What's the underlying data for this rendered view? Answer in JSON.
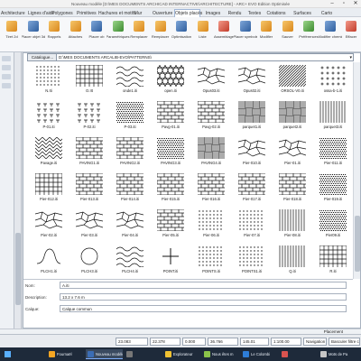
{
  "window": {
    "title": "Nouveau modèle [D:\\MES DOCUMENTS ARCHICAD INTERNACTIVE\\ARCHITECTURE] - ARC+ EVO Edition Optimisée"
  },
  "tabs": [
    "Architecture",
    "Lignes d'aide",
    "Polygones",
    "Primitives",
    "Hachures et motifs",
    "Mur",
    "Ouverture",
    "Objets placés",
    "Images",
    "Rendu",
    "Textes",
    "Cotations",
    "Surfaces",
    "Carto"
  ],
  "active_tab": 7,
  "ribbon": [
    "Tiret 2d",
    "Placer objet 3d",
    "Rappels",
    "Attaches",
    "Placer ob",
    "Paramétriques",
    "Remplacer",
    "Remplacer",
    "Optimisation",
    "Liste",
    "Assemblage",
    "Placer symbole",
    "Modifier",
    "Sauver",
    "Préférences",
    "Modifier chemin",
    "Effacer"
  ],
  "dialog": {
    "catalog_button": "Catalogue...",
    "path": "D:\\MES DOCUMENTS ARCALIB-EVO\\PATTERNS\\",
    "patterns": [
      {
        "label": "N.Iti",
        "kind": "dots"
      },
      {
        "label": "O.IIt",
        "kind": "grid"
      },
      {
        "label": "onde1.iti",
        "kind": "wave"
      },
      {
        "label": "open.iti",
        "kind": "hex"
      },
      {
        "label": "Opus03.iti",
        "kind": "stone"
      },
      {
        "label": "Opus02.iti",
        "kind": "stone"
      },
      {
        "label": "ORSOL-V0.iti",
        "kind": "diag"
      },
      {
        "label": "ossa-b-1.iti",
        "kind": "cross"
      },
      {
        "label": "P-01.iti",
        "kind": "tee"
      },
      {
        "label": "P-02.iti",
        "kind": "tee"
      },
      {
        "label": "P-03.iti",
        "kind": "dense"
      },
      {
        "label": "Pavg-01.iti",
        "kind": "brick"
      },
      {
        "label": "Pavg-02.iti",
        "kind": "brick"
      },
      {
        "label": "parquet1.iti",
        "kind": "parquet"
      },
      {
        "label": "parquet2.iti",
        "kind": "parquet"
      },
      {
        "label": "parquet3.iti",
        "kind": "vlines"
      },
      {
        "label": "Pavage.iti",
        "kind": "herring"
      },
      {
        "label": "PAVING1.iti",
        "kind": "brick"
      },
      {
        "label": "PAVING2.iti",
        "kind": "brick"
      },
      {
        "label": "PAVING3.iti",
        "kind": "dense"
      },
      {
        "label": "PAVING4.iti",
        "kind": "parquet"
      },
      {
        "label": "Pier-010.iti",
        "kind": "stone"
      },
      {
        "label": "Pier-01.iti",
        "kind": "stone"
      },
      {
        "label": "Pier-011.iti",
        "kind": "dense"
      },
      {
        "label": "Pier-012.iti",
        "kind": "grid"
      },
      {
        "label": "Pier-013.iti",
        "kind": "brick"
      },
      {
        "label": "Pier-014.iti",
        "kind": "brick"
      },
      {
        "label": "Pier-015.iti",
        "kind": "brick"
      },
      {
        "label": "Pier-016.iti",
        "kind": "brick"
      },
      {
        "label": "Pier-017.iti",
        "kind": "brick"
      },
      {
        "label": "Pier-018.iti",
        "kind": "brick"
      },
      {
        "label": "Pier-019.iti",
        "kind": "dense"
      },
      {
        "label": "Pier-02.iti",
        "kind": "stone"
      },
      {
        "label": "Pier-03.iti",
        "kind": "stone"
      },
      {
        "label": "Pier-04.iti",
        "kind": "stone"
      },
      {
        "label": "Pier-05.iti",
        "kind": "brick"
      },
      {
        "label": "Pier-06.iti",
        "kind": "dots"
      },
      {
        "label": "Pier-07.iti",
        "kind": "dots"
      },
      {
        "label": "Pier-08.iti",
        "kind": "vlines"
      },
      {
        "label": "Pier09.iti",
        "kind": "dense"
      },
      {
        "label": "PLCH1.iti",
        "kind": "curve"
      },
      {
        "label": "PLCH3.iti",
        "kind": "circle"
      },
      {
        "label": "PLCH4.iti",
        "kind": "wave"
      },
      {
        "label": "POINT.iti",
        "kind": "plus"
      },
      {
        "label": "POINTS.iti",
        "kind": "dots"
      },
      {
        "label": "POINTS1.iti",
        "kind": "dots"
      },
      {
        "label": "Q.iti",
        "kind": "vlines"
      },
      {
        "label": "R.iti",
        "kind": "grid"
      }
    ],
    "fields": [
      {
        "label": "Nom:",
        "value": "A.iti"
      },
      {
        "label": "Description:",
        "value": "13.2 x 7.6 m"
      },
      {
        "label": "Calque:",
        "value": "Calque commun"
      }
    ]
  },
  "status": {
    "placement": "Placement",
    "x": "23.083",
    "y": "22.378",
    "angle": "0.000",
    "dx": "36.766",
    "dy": "145.01",
    "scale": "1:100.00",
    "nav": "Navigation",
    "filter": "Basculer filtre ca"
  },
  "taskbar": [
    "Fournaël",
    "Nouveau modèle",
    "",
    "Explorateur",
    "Nous êtes m",
    "Le Colombi",
    "",
    "Mots de Pa"
  ]
}
